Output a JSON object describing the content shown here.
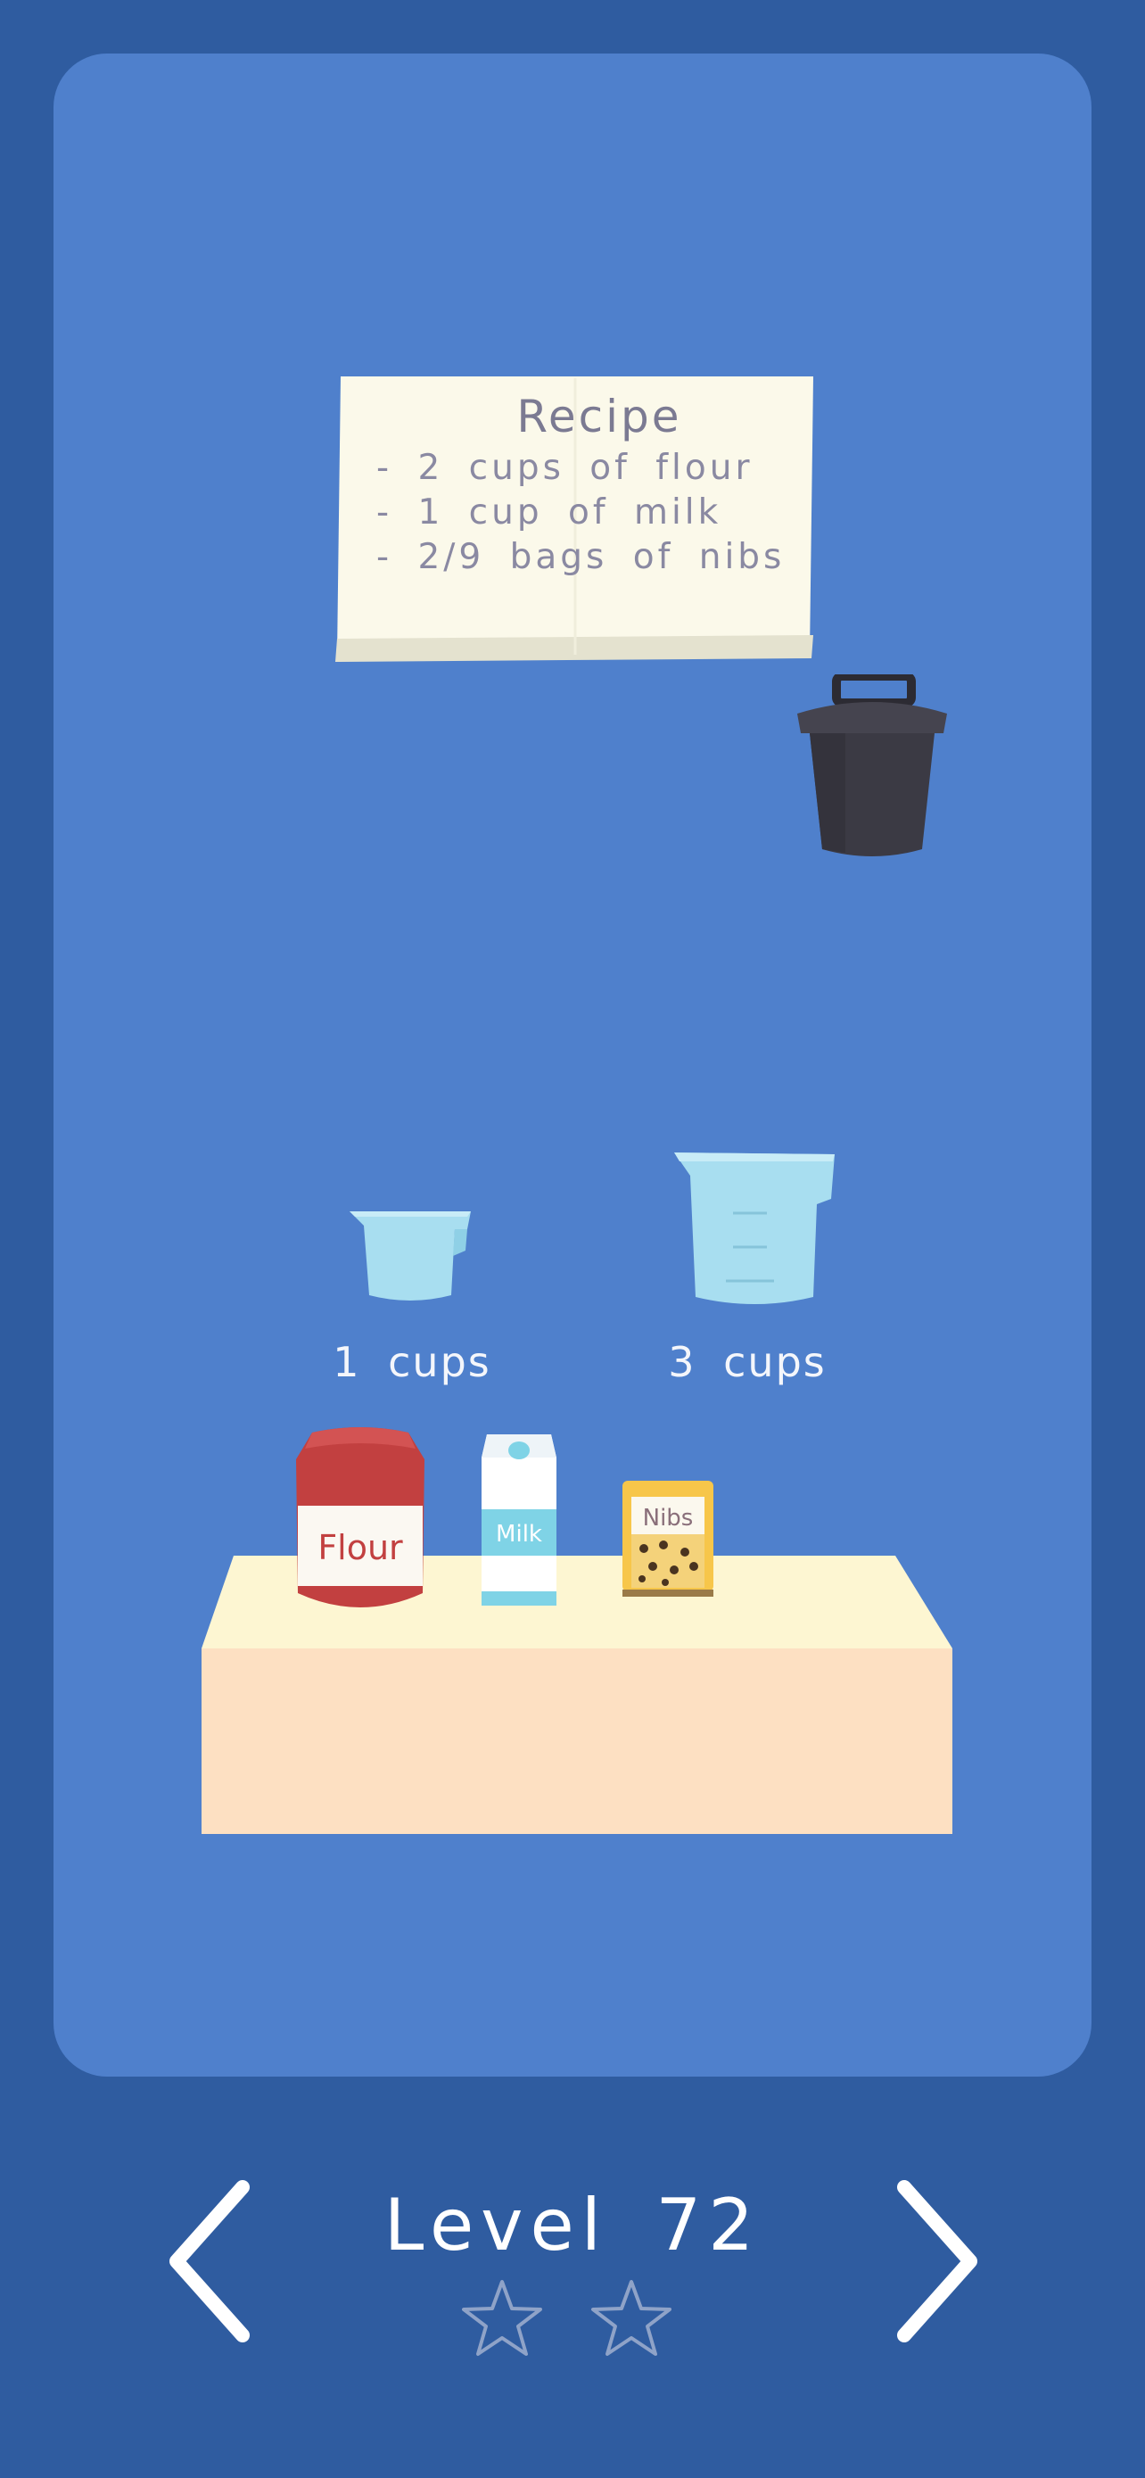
{
  "recipe": {
    "title": "Recipe",
    "lines": [
      "- 2 cups of flour",
      "- 1 cup of milk",
      "- 2/9 bags of nibs"
    ]
  },
  "cups": [
    {
      "label": "1 cups"
    },
    {
      "label": "3 cups"
    }
  ],
  "ingredients": {
    "flour": "Flour",
    "milk": "Milk",
    "nibs": "Nibs"
  },
  "footer": {
    "level_label": "Level 72",
    "stars_earned": 0,
    "stars_total": 2
  },
  "colors": {
    "background": "#2f5ca0",
    "card": "#4f80cc",
    "cup": "#a8def0",
    "flour_bag": "#c24040",
    "table_top": "#fdf6d2",
    "table_front": "#fde0c2",
    "trash": "#3b3a44"
  },
  "icons": {
    "prev": "chevron-left-icon",
    "next": "chevron-right-icon",
    "star": "star-outline-icon",
    "trash": "trash-can-icon"
  }
}
